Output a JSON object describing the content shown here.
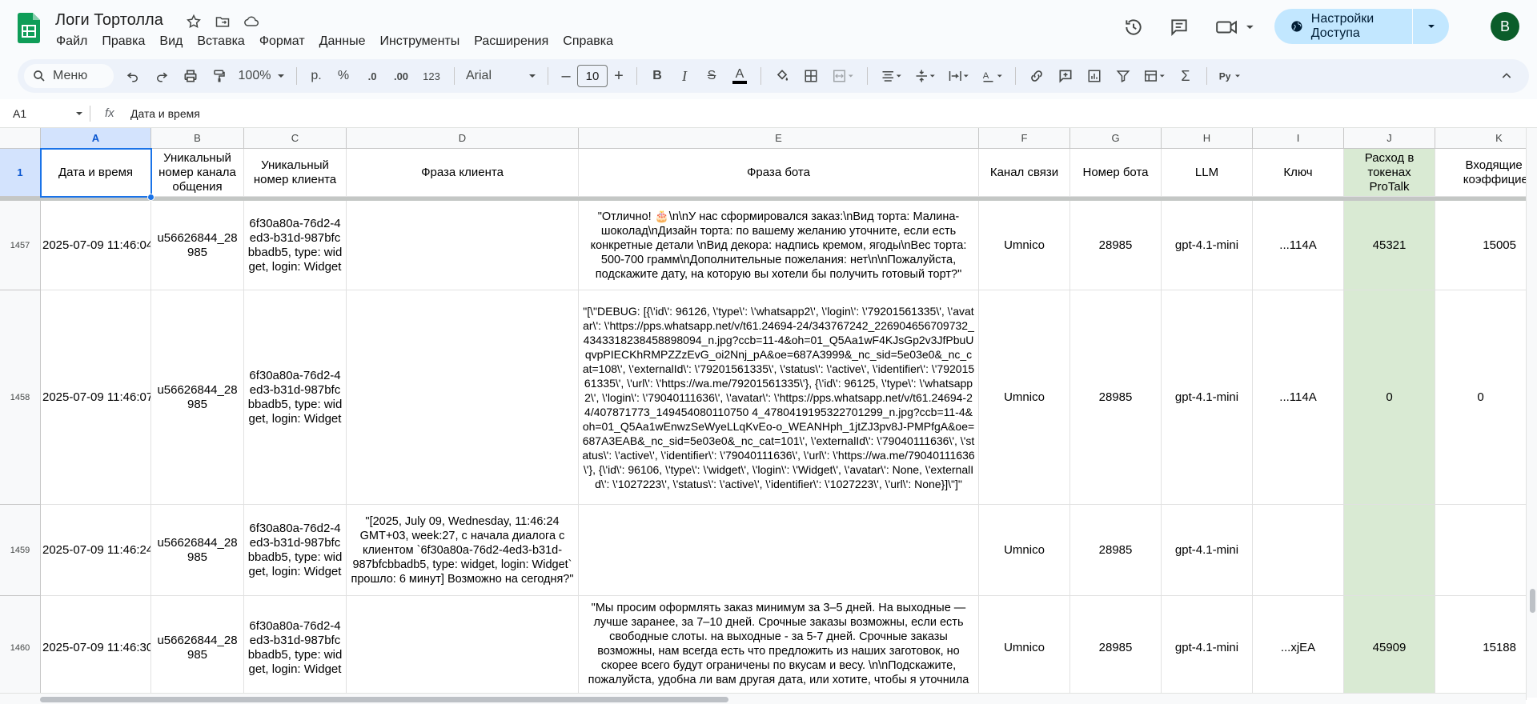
{
  "app": {
    "title": "Логи Тортолла",
    "menu": [
      "Файл",
      "Правка",
      "Вид",
      "Вставка",
      "Формат",
      "Данные",
      "Инструменты",
      "Расширения",
      "Справка"
    ],
    "share_label": "Настройки Доступа",
    "avatar_letter": "B",
    "accent": "#1a73e8",
    "header_green": "#d9ead3"
  },
  "toolbar": {
    "search_label": "Меню",
    "zoom": "100%",
    "currency": "р.",
    "percent": "%",
    "dec_decrease": ".0",
    "dec_increase": ".00",
    "number_format": "123",
    "font": "Arial",
    "font_size": "10"
  },
  "formula_bar": {
    "cell_ref": "A1",
    "fx": "fx",
    "content": "Дата и время"
  },
  "columns": [
    "A",
    "B",
    "C",
    "D",
    "E",
    "F",
    "G",
    "H",
    "I",
    "J",
    "K"
  ],
  "header_row": {
    "number": "1",
    "cells": [
      "Дата и время",
      "Уникальный номер канала общения",
      "Уникальный номер клиента",
      "Фраза клиента",
      "Фраза бота",
      "Канал связи",
      "Номер бота",
      "LLM",
      "Ключ",
      "Расход в токенах ProTalk",
      "Входящие б коэффициен"
    ]
  },
  "rows": [
    {
      "number": "1457",
      "cells": [
        "2025-07-09 11:46:04",
        "u56626844_28985",
        "6f30a80a-76d2-4ed3-b31d-987bfcbbadb5, type: widget, login: Widget",
        "",
        "\"Отлично! 🎂\\n\\nУ нас сформировался заказ:\\nВид торта: Малина-шоколад\\nДизайн торта: по вашему желанию уточните, если есть конкретные детали \\nВид декора: надпись кремом, ягоды\\nВес торта: 500-700 грамм\\nДополнительные пожелания: нет\\n\\nПожалуйста, подскажите дату, на которую вы хотели бы получить готовый торт?\"",
        "Umnico",
        "28985",
        "gpt-4.1-mini",
        "...114A",
        "45321",
        "15005"
      ]
    },
    {
      "number": "1458",
      "cells": [
        "2025-07-09 11:46:07",
        "u56626844_28985",
        "6f30a80a-76d2-4ed3-b31d-987bfcbbadb5, type: widget, login: Widget",
        "",
        "\"[\\\"DEBUG: [{\\'id\\': 96126, \\'type\\': \\'whatsapp2\\', \\'login\\': \\'79201561335\\', \\'avatar\\': \\'https://pps.whatsapp.net/v/t61.24694-24/343767242_226904656709732_4343318238458898094_n.jpg?ccb=11-4&oh=01_Q5Aa1wF4KJsGp2v3JfPbuUqvpPIECKhRMPZZzEvG_oi2Nnj_pA&oe=687A3999&_nc_sid=5e03e0&_nc_cat=108\\', \\'externalId\\': \\'79201561335\\', \\'status\\': \\'active\\', \\'identifier\\': \\'79201561335\\', \\'url\\': \\'https://wa.me/79201561335\\'}, {\\'id\\': 96125, \\'type\\': \\'whatsapp2\\', \\'login\\': \\'79040111636\\', \\'avatar\\': \\'https://pps.whatsapp.net/v/t61.24694-24/407871773_149454080110750 4_4780419195322701299_n.jpg?ccb=11-4&oh=01_Q5Aa1wEnwzSeWyeLLqKvEo-o_WEANHph_1jtZJ3pv8J-PMPfgA&oe=687A3EAB&_nc_sid=5e03e0&_nc_cat=101\\', \\'externalId\\': \\'79040111636\\', \\'status\\': \\'active\\', \\'identifier\\': \\'79040111636\\', \\'url\\': \\'https://wa.me/79040111636\\'}, {\\'id\\': 96106, \\'type\\': \\'widget\\', \\'login\\': \\'Widget\\', \\'avatar\\': None, \\'externalId\\': \\'1027223\\', \\'status\\': \\'active\\', \\'identifier\\': \\'1027223\\', \\'url\\': None}]\\\"]\"",
        "Umnico",
        "28985",
        "gpt-4.1-mini",
        "...114A",
        "0",
        "0"
      ]
    },
    {
      "number": "1459",
      "cells": [
        "2025-07-09 11:46:24",
        "u56626844_28985",
        "6f30a80a-76d2-4ed3-b31d-987bfcbbadb5, type: widget, login: Widget",
        "\"[2025, July 09, Wednesday, 11:46:24 GMT+03, week:27, с начала диалога с клиентом `6f30a80a-76d2-4ed3-b31d-987bfcbbadb5, type: widget, login: Widget` прошло: 6 минут] Возможно на сегодня?\"",
        "",
        "Umnico",
        "28985",
        "gpt-4.1-mini",
        "",
        "",
        ""
      ]
    },
    {
      "number": "1460",
      "cells": [
        "2025-07-09 11:46:30",
        "u56626844_28985",
        "6f30a80a-76d2-4ed3-b31d-987bfcbbadb5, type: widget, login: Widget",
        "",
        "\"Мы просим оформлять заказ минимум за 3–5 дней. На выходные — лучше заранее, за 7–10 дней. Срочные заказы возможны, если есть свободные слоты. на выходные - за 5-7 дней. Срочные заказы возможны, нам всегда есть что предложить из наших заготовок, но скорее всего будут ограничены по вкусам и весу. \\n\\nПодскажите, пожалуйста, удобна ли вам другая дата, или хотите, чтобы я уточнила",
        "Umnico",
        "28985",
        "gpt-4.1-mini",
        "...xjEA",
        "45909",
        "15188"
      ]
    }
  ]
}
